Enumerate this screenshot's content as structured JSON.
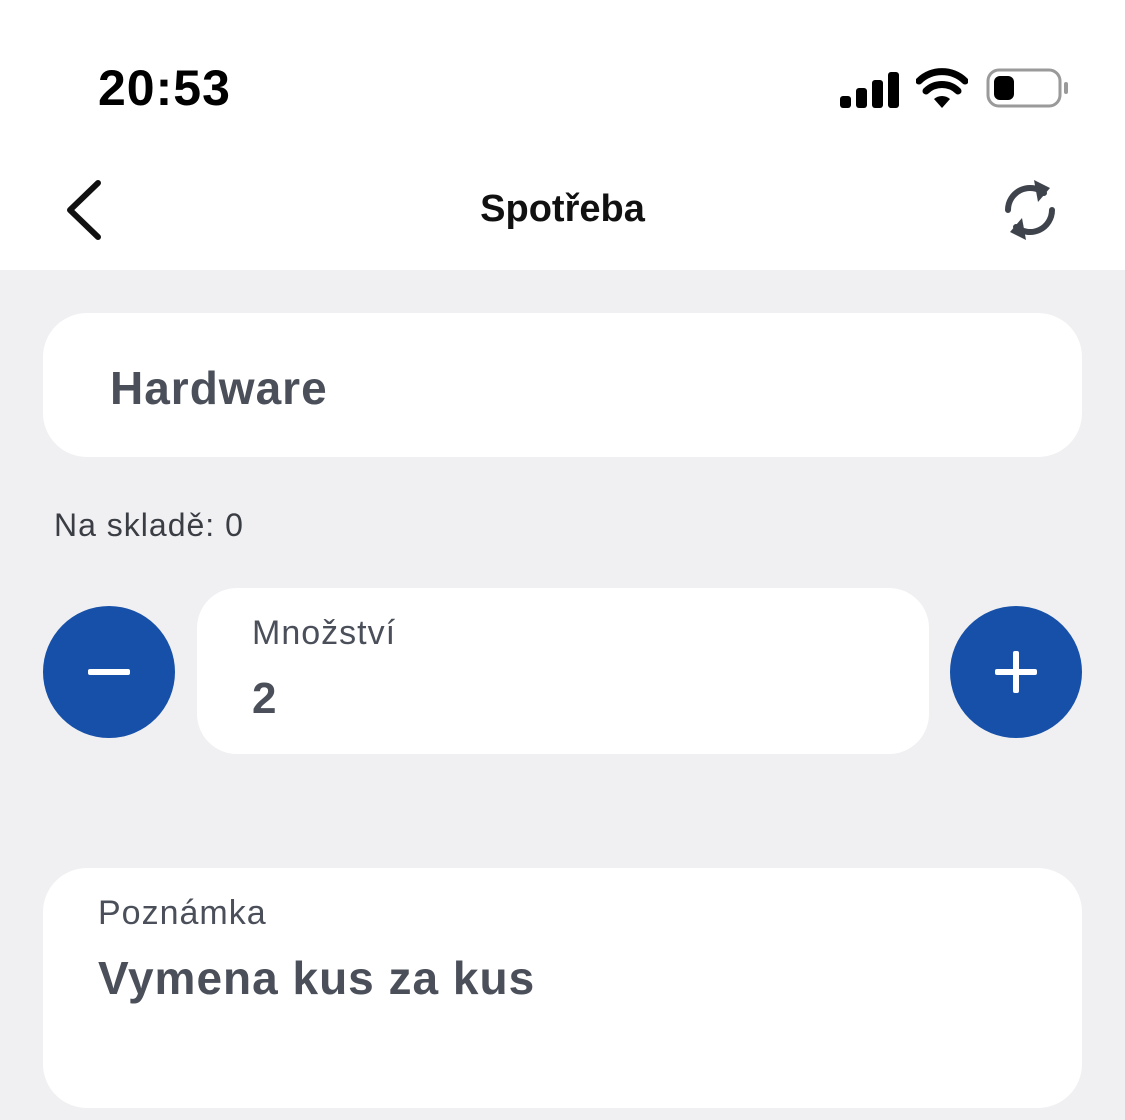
{
  "status_bar": {
    "time": "20:53",
    "icons": [
      "signal-icon",
      "wifi-icon",
      "battery-icon"
    ]
  },
  "nav": {
    "title": "Spotřeba",
    "back_icon": "chevron-left-icon",
    "refresh_icon": "refresh-icon"
  },
  "item": {
    "name": "Hardware"
  },
  "stock": {
    "text": "Na skladě: 0"
  },
  "quantity": {
    "label": "Množství",
    "value": "2",
    "decrement_icon": "minus-icon",
    "increment_icon": "plus-icon"
  },
  "note": {
    "label": "Poznámka",
    "value": "Vymena kus za kus"
  },
  "colors": {
    "accent": "#1650a8",
    "background": "#f0f0f2",
    "card": "#ffffff",
    "text_muted": "#4a4f5a"
  }
}
